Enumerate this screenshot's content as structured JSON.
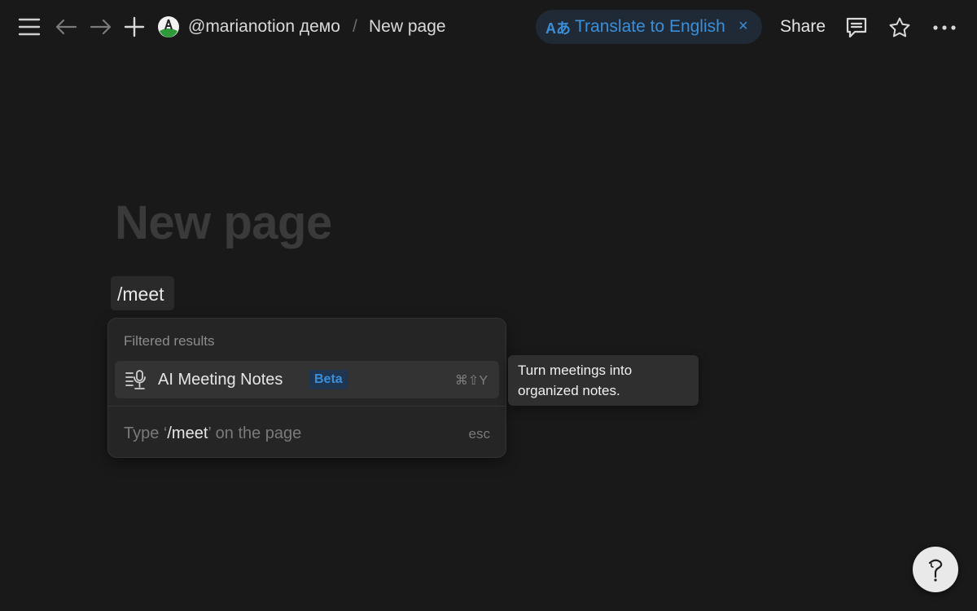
{
  "topbar": {
    "workspace": "@marianotion демо",
    "separator": "/",
    "page": "New page",
    "translate_label": "Translate to English",
    "translate_glyph": "Aあ",
    "translate_close": "×",
    "share_label": "Share"
  },
  "page": {
    "title": "New page",
    "block_text": "/meet"
  },
  "menu": {
    "heading": "Filtered results",
    "item_label": "AI Meeting Notes",
    "item_badge": "Beta",
    "item_shortcut": "⌘⇧Y",
    "footer_prefix": "Type ‘",
    "footer_cmd": "/meet",
    "footer_suffix": "’ on the page",
    "esc_label": "esc"
  },
  "tooltip": {
    "line1": "Turn meetings into",
    "line2": "organized notes."
  },
  "help": {
    "glyph": "?"
  },
  "colors": {
    "background": "#191919",
    "accent_blue": "#3b8fd9",
    "menu_bg": "#252525"
  }
}
